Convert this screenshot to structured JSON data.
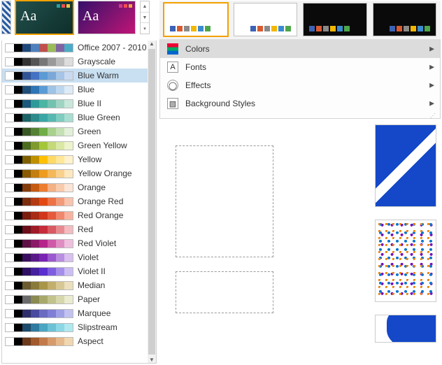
{
  "themes": [
    {
      "aa": "Aa",
      "dots": [
        "#2aa0a0",
        "#e94f4f",
        "#f2c23e"
      ]
    },
    {
      "aa": "Aa",
      "dots": [
        "#d03b84",
        "#f24f4f",
        "#f2a63e"
      ]
    }
  ],
  "variants_palette": [
    "#3b62b5",
    "#d85a32",
    "#8a8a8a",
    "#f2b705",
    "#3a8bcf",
    "#4ea64b"
  ],
  "side_menu": {
    "items": [
      {
        "label": "Colors"
      },
      {
        "label": "Fonts"
      },
      {
        "label": "Effects"
      },
      {
        "label": "Background Styles"
      }
    ]
  },
  "color_schemes": [
    {
      "label": "Office 2007 - 2010",
      "swatches": [
        "#ffffff",
        "#000000",
        "#1f497d",
        "#4f81bd",
        "#c0504d",
        "#9bbb59",
        "#8064a2",
        "#4bacc6"
      ]
    },
    {
      "label": "Grayscale",
      "swatches": [
        "#ffffff",
        "#000000",
        "#333333",
        "#555555",
        "#777777",
        "#999999",
        "#bbbbbb",
        "#dddddd"
      ]
    },
    {
      "label": "Blue Warm",
      "swatches": [
        "#ffffff",
        "#000000",
        "#2f5496",
        "#4472c4",
        "#5b9bd5",
        "#7ba8d9",
        "#a5c4e6",
        "#c9daf0"
      ],
      "hl": true
    },
    {
      "label": "Blue",
      "swatches": [
        "#ffffff",
        "#000000",
        "#1f4e79",
        "#2e75b6",
        "#5b9bd5",
        "#9dc3e6",
        "#bdd7ee",
        "#deebf7"
      ]
    },
    {
      "label": "Blue II",
      "swatches": [
        "#ffffff",
        "#000000",
        "#1b587c",
        "#2e9999",
        "#4ab5a3",
        "#73c2b0",
        "#9fd4c3",
        "#c8e7db"
      ]
    },
    {
      "label": "Blue Green",
      "swatches": [
        "#ffffff",
        "#000000",
        "#1c6366",
        "#2e8b8b",
        "#3aa6a6",
        "#56b8b0",
        "#7fccc0",
        "#a8ded1"
      ]
    },
    {
      "label": "Green",
      "swatches": [
        "#ffffff",
        "#000000",
        "#385723",
        "#548235",
        "#70ad47",
        "#a9d18e",
        "#c5e0b4",
        "#e2f0d9"
      ]
    },
    {
      "label": "Green Yellow",
      "swatches": [
        "#ffffff",
        "#000000",
        "#4b6b1e",
        "#7f9b2e",
        "#a4c639",
        "#c4d978",
        "#d9e8a3",
        "#eef3cd"
      ]
    },
    {
      "label": "Yellow",
      "swatches": [
        "#ffffff",
        "#000000",
        "#7f6000",
        "#bf8f00",
        "#ffc000",
        "#ffd966",
        "#ffe699",
        "#fff2cc"
      ]
    },
    {
      "label": "Yellow Orange",
      "swatches": [
        "#ffffff",
        "#000000",
        "#8a5a00",
        "#c47f12",
        "#ed9b21",
        "#f4b85a",
        "#f9d08c",
        "#fde7bf"
      ]
    },
    {
      "label": "Orange",
      "swatches": [
        "#ffffff",
        "#000000",
        "#843c0c",
        "#c55a11",
        "#ed7d31",
        "#f4b183",
        "#f8cbad",
        "#fbe5d6"
      ]
    },
    {
      "label": "Orange Red",
      "swatches": [
        "#ffffff",
        "#000000",
        "#7b2d0e",
        "#b33a12",
        "#e24912",
        "#ed7245",
        "#f29b7a",
        "#f8c4ae"
      ]
    },
    {
      "label": "Red Orange",
      "swatches": [
        "#ffffff",
        "#000000",
        "#7b1c0e",
        "#a82a14",
        "#d1361a",
        "#e55a3b",
        "#ef876c",
        "#f7b39f"
      ]
    },
    {
      "label": "Red",
      "swatches": [
        "#ffffff",
        "#000000",
        "#6b0f1a",
        "#9e1b28",
        "#c72c3b",
        "#d95a63",
        "#e88b91",
        "#f3bcc0"
      ]
    },
    {
      "label": "Red Violet",
      "swatches": [
        "#ffffff",
        "#000000",
        "#5e1046",
        "#8a1a68",
        "#b5248a",
        "#cf59a8",
        "#e08dc3",
        "#efc0de"
      ]
    },
    {
      "label": "Violet",
      "swatches": [
        "#ffffff",
        "#000000",
        "#3b0f5e",
        "#5a1a8a",
        "#7a24b5",
        "#9a59cf",
        "#b98de0",
        "#d9c0ef"
      ]
    },
    {
      "label": "Violet II",
      "swatches": [
        "#ffffff",
        "#000000",
        "#2e1065",
        "#4520a0",
        "#5a2ecf",
        "#7e5ee0",
        "#a58ee9",
        "#ccbef2"
      ]
    },
    {
      "label": "Median",
      "swatches": [
        "#ffffff",
        "#000000",
        "#6b5b2e",
        "#8a7a3a",
        "#a89548",
        "#c2af6b",
        "#d7c794",
        "#ebdfbe"
      ]
    },
    {
      "label": "Paper",
      "swatches": [
        "#ffffff",
        "#000000",
        "#6b6b6b",
        "#8a8a52",
        "#a8a86b",
        "#c2c28c",
        "#d7d7ad",
        "#ebebd0"
      ]
    },
    {
      "label": "Marquee",
      "swatches": [
        "#ffffff",
        "#000000",
        "#2e2e6b",
        "#4a4aa0",
        "#6b6bc2",
        "#7f7fd7",
        "#a0a0e5",
        "#c2c2f0"
      ]
    },
    {
      "label": "Slipstream",
      "swatches": [
        "#ffffff",
        "#000000",
        "#1b4a6b",
        "#2e7aa0",
        "#4aa6c2",
        "#6bc2d7",
        "#8cd7e5",
        "#b0e8f0"
      ]
    },
    {
      "label": "Aspect",
      "swatches": [
        "#ffffff",
        "#000000",
        "#6b3a1b",
        "#a05a2e",
        "#c27a4a",
        "#d79a6b",
        "#e5b98c",
        "#f0d7b0"
      ]
    }
  ]
}
